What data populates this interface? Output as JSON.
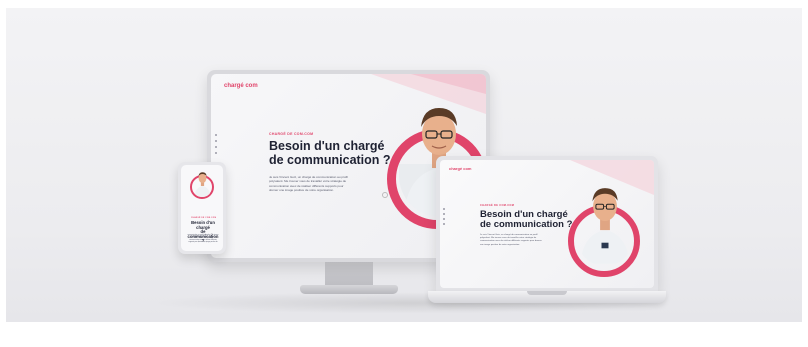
{
  "site": {
    "logo": "chargé com",
    "eyebrow": "CHARGÉ DE COM.COM",
    "headline_line1": "Besoin d'un chargé",
    "headline_line2": "de communication ?",
    "intro": "Je suis Vincent Guiz, un chargé de communication au profil polyvalent. Me trouver vous de travailler votre stratégie de communication avec de réaliser différents supports pour donner une image positive de votre organisation."
  },
  "colors": {
    "accent": "#e0446a",
    "headline": "#1f2233",
    "device_frame": "#d9d9dd",
    "background": "#ececef"
  }
}
